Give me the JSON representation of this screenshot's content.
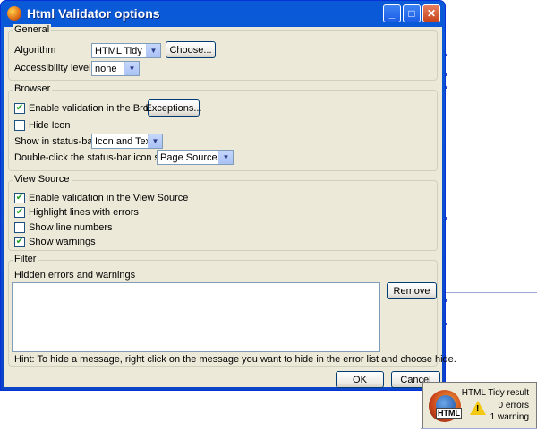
{
  "window": {
    "title": "Html Validator options"
  },
  "general": {
    "legend": "General",
    "algorithm_label": "Algorithm",
    "algorithm_value": "HTML Tidy",
    "choose_button": "Choose...",
    "accessibility_label": "Accessibility level",
    "accessibility_value": "none"
  },
  "browser": {
    "legend": "Browser",
    "enable_validation": "Enable validation in the Browser",
    "exceptions_button": "Exceptions...",
    "hide_icon": "Hide Icon",
    "status_bar_label": "Show in status-bar",
    "status_bar_value": "Icon and Text",
    "dblclick_label": "Double-click the status-bar icon starts:",
    "dblclick_value": "Page Source..."
  },
  "view_source": {
    "legend": "View Source",
    "enable_validation": "Enable validation in the View Source",
    "highlight_lines": "Highlight lines with errors",
    "show_line_numbers": "Show line numbers",
    "show_warnings": "Show warnings"
  },
  "checkbox_states": {
    "enable_browser": true,
    "hide_icon": false,
    "enable_view_source": true,
    "highlight_lines": true,
    "show_line_numbers": false,
    "show_warnings": true
  },
  "filter": {
    "legend": "Filter",
    "hidden_label": "Hidden errors and warnings",
    "remove_button": "Remove",
    "hint": "Hint: To hide a message, right click on the message you want to hide in the error list and choose hide."
  },
  "footer": {
    "ok": "OK",
    "cancel": "Cancel"
  },
  "popup": {
    "title": "HTML Tidy result",
    "errors": "0 errors",
    "warnings": "1 warning",
    "html_tag": "HTML"
  },
  "colors": {
    "titlebar": "#0b4ad0",
    "client": "#ece9d8",
    "check": "#21a121"
  }
}
